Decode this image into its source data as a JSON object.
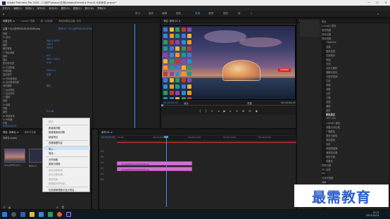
{
  "app": {
    "title": "Adobe Premiere Pro 2020 - C:\\用户\\lenovo\\文档\\Adobe\\Premiere Pro\\14.0\\未命名.prproj *",
    "min": "—",
    "max": "☐",
    "close": "✕"
  },
  "menu": [
    "文件(F)",
    "编辑(E)",
    "剪辑(C)",
    "序列(S)",
    "标记(M)",
    "图形(G)",
    "视图(V)",
    "窗口(W)",
    "帮助(H)"
  ],
  "workspaces": [
    "学习",
    "组件",
    "编辑",
    "颜色",
    "效果",
    "音频",
    "图形",
    "库"
  ],
  "active_workspace": "效果",
  "effect_controls": {
    "tabs": [
      "效果控件 ≡",
      "Lumetri 范围",
      "源: (无剪辑)",
      "音频剪辑混合器: 序列"
    ],
    "clip": "主要 * 0(1)@PP20191023CAP.png",
    "seq": "序列 01 * 0(1)@PP20191023CAP.png",
    "timecode": "00;00;00;00",
    "rows": [
      {
        "label": "视频",
        "value": ""
      },
      {
        "label": "fx 运动",
        "value": ""
      },
      {
        "label": "位置",
        "value": "360.0   240.0"
      },
      {
        "label": "缩放",
        "value": "100.0"
      },
      {
        "label": "缩放宽度",
        "value": "100.0"
      },
      {
        "label": "☑ 等比缩放",
        "value": ""
      },
      {
        "label": "旋转",
        "value": "0.0"
      },
      {
        "label": "锚点",
        "value": "360.0   240.0"
      },
      {
        "label": "防闪烁滤镜",
        "value": "0.00"
      },
      {
        "label": "fx 不透明度",
        "value": ""
      },
      {
        "label": "不透明度",
        "value": "100.0 %"
      },
      {
        "label": "混合模式",
        "value": "正常"
      },
      {
        "label": "fx 时间重映射",
        "value": ""
      },
      {
        "label": "fx 自动重新构图",
        "value": ""
      },
      {
        "label": "动作跟踪",
        "value": "默认"
      },
      {
        "label": "☐ 运动预设",
        "value": ""
      },
      {
        "label": "☐ 自动重构",
        "value": ""
      },
      {
        "label": "☐ 跟踪",
        "value": ""
      },
      {
        "label": "音频",
        "value": ""
      },
      {
        "label": "fx 音量",
        "value": ""
      },
      {
        "label": "旁路",
        "value": ""
      },
      {
        "label": "级别",
        "value": "0.0 dB"
      },
      {
        "label": "fx 声道音量",
        "value": ""
      },
      {
        "label": "fx 声像器",
        "value": ""
      },
      {
        "label": "平衡",
        "value": "0.0"
      }
    ],
    "footer_time": "00;00;00;00"
  },
  "program_monitor": {
    "tab": "节目: 序列 01 ≡",
    "timecode": "00;00;00;00",
    "fit": "适合",
    "quality": "完整",
    "duration": "00;00;04;29",
    "lenovo": "Lenovo"
  },
  "project_panel": {
    "tabs": [
      "项目: 未命名 ≡",
      "媒体浏览器",
      "库"
    ],
    "name": "未命名.prproj",
    "items": [
      "0(1)@PP2019...",
      "序列 01"
    ]
  },
  "context_menu": {
    "items": [
      {
        "label": "粘贴",
        "disabled": true
      },
      {
        "label": "新建素材箱",
        "disabled": false
      },
      {
        "label": "新建搜索素材箱",
        "disabled": false
      },
      {
        "label": "新建项目",
        "disabled": false
      },
      {
        "label": "查看隐藏内容",
        "disabled": false
      },
      {
        "label": "导入...",
        "disabled": false,
        "highlight": true
      },
      {
        "label": "查找...",
        "disabled": false
      },
      {
        "label": "对齐网格",
        "disabled": false
      },
      {
        "label": "重置为网格",
        "disabled": false
      },
      {
        "label": "保存当前布局",
        "disabled": true
      },
      {
        "label": "另存为新布局...",
        "disabled": true
      },
      {
        "label": "调用布局",
        "disabled": true
      },
      {
        "label": "管理保存的布局...",
        "disabled": true
      },
      {
        "label": "在资源管理器中显示项目...",
        "disabled": false
      }
    ]
  },
  "timeline": {
    "tab": "序列 01 ≡",
    "timecode": "00;00;00;00",
    "ruler": [
      "00;00",
      "00;00;05;00",
      "00;00;10;00",
      "00;00;15;00",
      "00;00;20;00"
    ],
    "tracks": [
      "V3",
      "V2",
      "V1",
      "A1",
      "A2",
      "A3"
    ],
    "clip_v": "0(1)@PP20191023CAP.png",
    "clip_v2": "0(1)@PP20191023CAP.png"
  },
  "effects": {
    "items": [
      "预设",
      "Lumetri 预设",
      "音频效果",
      "音频过渡",
      "视频效果",
      "Obsolete",
      "变换",
      "图像控制",
      "实用程序",
      "扭曲",
      "时间",
      "杂色与颗粒",
      "模糊与锐化",
      "沉浸式视频",
      "生成",
      "视频",
      "调整",
      "过时",
      "过渡",
      "透视",
      "通道",
      "键控",
      "颜色校正",
      "ASC CDL",
      "Lumetri 颜色",
      "亮度与对比度",
      "广播颜色",
      "更改为颜色",
      "更改颜色",
      "色彩",
      "视频限幅器",
      "通道混合器",
      "颜色平衡",
      "风格化",
      "视频过渡",
      "3D 运动",
      "Iris",
      "沉浸式视频",
      "溶解",
      "擦除",
      "滑动",
      "缩放",
      "页面剥落"
    ],
    "selected": "颜色校正"
  },
  "taskbar": {
    "time": "13:12",
    "date": "2021/10/24"
  },
  "watermark": "最需教育",
  "colors": {
    "accent": "#4b8ee8",
    "clip": "#d26fd4",
    "lenovo": "#e2231a",
    "watermark": "#2d5ec9"
  }
}
